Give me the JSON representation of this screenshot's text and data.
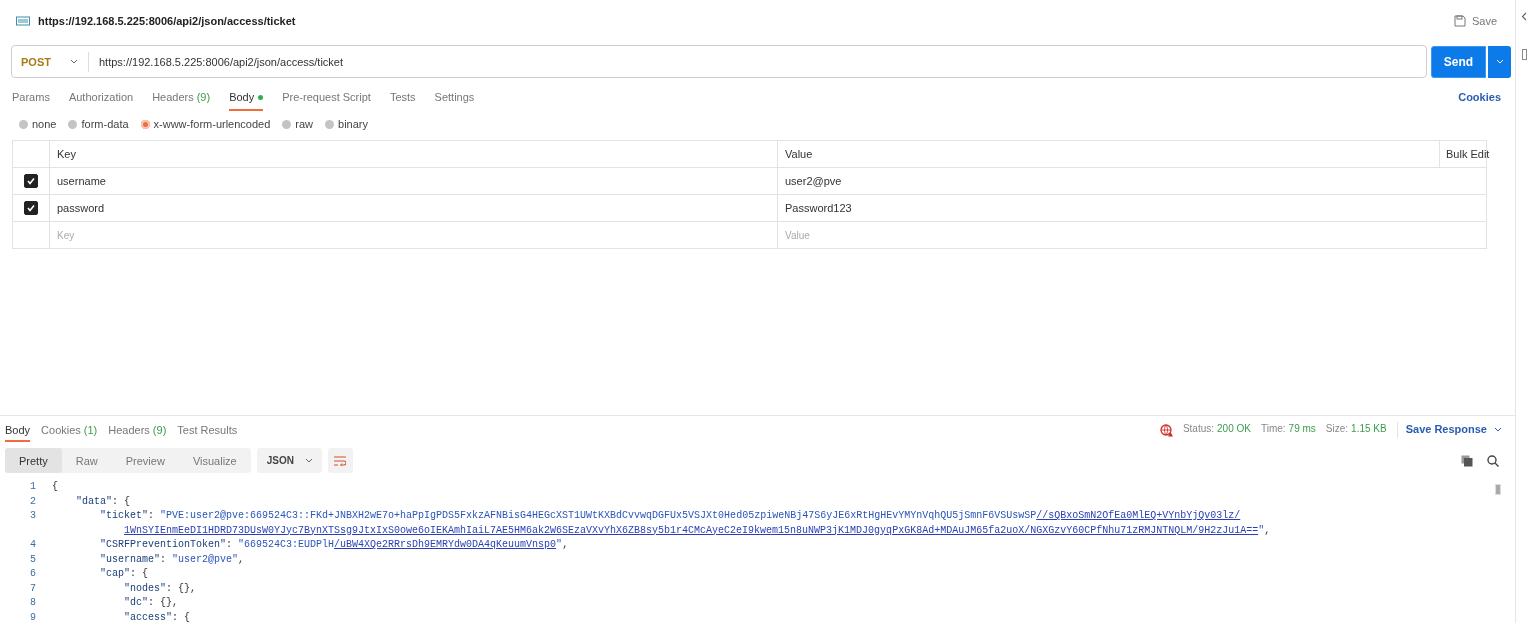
{
  "request_title": "https://192.168.5.225:8006/api2/json/access/ticket",
  "save": "Save",
  "request": {
    "method": "POST",
    "url": "https://192.168.5.225:8006/api2/json/access/ticket",
    "send": "Send"
  },
  "tabs": [
    {
      "label": "Params",
      "selected": false
    },
    {
      "label": "Authorization",
      "selected": false
    },
    {
      "label": "Headers",
      "count": "(9)",
      "selected": false
    },
    {
      "label": "Body",
      "selected": true,
      "indicator": true
    },
    {
      "label": "Pre-request Script",
      "selected": false
    },
    {
      "label": "Tests",
      "selected": false
    },
    {
      "label": "Settings",
      "selected": false
    }
  ],
  "cookies_link": "Cookies",
  "body_types": [
    {
      "label": "none",
      "selected": false
    },
    {
      "label": "form-data",
      "selected": false
    },
    {
      "label": "x-www-form-urlencoded",
      "selected": true
    },
    {
      "label": "raw",
      "selected": false
    },
    {
      "label": "binary",
      "selected": false
    }
  ],
  "params_table": {
    "columns": [
      "Key",
      "Value"
    ],
    "bulk_edit": "Bulk Edit",
    "rows": [
      {
        "checked": true,
        "key": "username",
        "value": "user2@pve"
      },
      {
        "checked": true,
        "key": "password",
        "value": "Password123"
      }
    ],
    "new_row": {
      "key_placeholder": "Key",
      "value_placeholder": "Value"
    }
  },
  "response": {
    "tabs": [
      {
        "label": "Body",
        "selected": true
      },
      {
        "label": "Cookies",
        "count": "(1)",
        "selected": false
      },
      {
        "label": "Headers",
        "count": "(9)",
        "selected": false
      },
      {
        "label": "Test Results",
        "selected": false
      }
    ],
    "status": {
      "label": "Status:",
      "value": "200 OK"
    },
    "time": {
      "label": "Time:",
      "value": "79 ms"
    },
    "size": {
      "label": "Size:",
      "value": "1.15 KB"
    },
    "save_response": "Save Response",
    "views": [
      {
        "label": "Pretty",
        "selected": true
      },
      {
        "label": "Raw",
        "selected": false
      },
      {
        "label": "Preview",
        "selected": false
      },
      {
        "label": "Visualize",
        "selected": false
      }
    ],
    "format": "JSON",
    "code_lines": [
      {
        "number": "1",
        "parts": [
          {
            "kind": "punct",
            "text": "{"
          }
        ]
      },
      {
        "number": "2",
        "parts": [
          {
            "kind": "key",
            "text": "    \"data\""
          },
          {
            "kind": "punct",
            "text": ": {"
          }
        ]
      },
      {
        "number": "3",
        "parts": [
          {
            "kind": "key",
            "text": "        \"ticket\""
          },
          {
            "kind": "punct",
            "text": ": "
          },
          {
            "kind": "string",
            "text": "\"PVE:user2@pve:669524C3::FKd+JNBXH2wE7o+haPpIgPDS5FxkzAFNBisG4HEGcXST1UWtKXBdCvvwqDGFUx5VSJXt0Hed05zpiweNBj47S6yJE6xRtHgHEvYMYnVqhQU5jSmnF6VSUswSP"
          },
          {
            "kind": "link",
            "text": "//sQBxoSmN2OfEa0MlEQ+VYnbYjQv03lz/"
          }
        ]
      },
      {
        "continuation": true,
        "parts": [
          {
            "kind": "link",
            "text": "1WnSYIEnmEeDI1HDRD73DUsW0YJyc7BynXTSsg9JtxIxS0owe6oIEKAmhIaiL7AE5HM6ak2W6SEzaVXvYhX6ZB8sy5b1r4CMcAyeC2eI9kwem15n8uNWP3jK1MDJ0gyqPxGK8Ad+MDAuJM65fa2uoX/NGXGzvY60CPfNhu71zRMJNTNQLM/9H2zJu1A=="
          },
          {
            "kind": "string",
            "text": "\""
          },
          {
            "kind": "punct",
            "text": ","
          }
        ]
      },
      {
        "number": "4",
        "parts": [
          {
            "kind": "key",
            "text": "        \"CSRFPreventionToken\""
          },
          {
            "kind": "punct",
            "text": ": "
          },
          {
            "kind": "string",
            "text": "\"669524C3:EUDPlH"
          },
          {
            "kind": "link",
            "text": "/uBW4XQe2RRrsDh9EMRYdw0DA4qKeuumVnsp0"
          },
          {
            "kind": "string",
            "text": "\""
          },
          {
            "kind": "punct",
            "text": ","
          }
        ]
      },
      {
        "number": "5",
        "parts": [
          {
            "kind": "key",
            "text": "        \"username\""
          },
          {
            "kind": "punct",
            "text": ": "
          },
          {
            "kind": "string",
            "text": "\"user2@pve\""
          },
          {
            "kind": "punct",
            "text": ","
          }
        ]
      },
      {
        "number": "6",
        "parts": [
          {
            "kind": "key",
            "text": "        \"cap\""
          },
          {
            "kind": "punct",
            "text": ": {"
          }
        ]
      },
      {
        "number": "7",
        "parts": [
          {
            "kind": "key",
            "text": "            \"nodes\""
          },
          {
            "kind": "punct",
            "text": ": {},"
          }
        ]
      },
      {
        "number": "8",
        "parts": [
          {
            "kind": "key",
            "text": "            \"dc\""
          },
          {
            "kind": "punct",
            "text": ": {},"
          }
        ]
      },
      {
        "number": "9",
        "parts": [
          {
            "kind": "key",
            "text": "            \"access\""
          },
          {
            "kind": "punct",
            "text": ": {"
          }
        ]
      }
    ]
  }
}
